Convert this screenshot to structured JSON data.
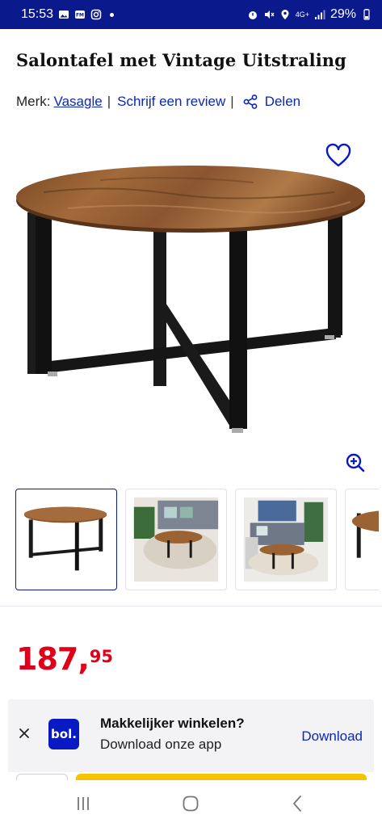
{
  "status_bar": {
    "time": "15:53",
    "network": "4G+",
    "battery": "29%"
  },
  "product": {
    "title": "Salontafel met Vintage Uitstraling",
    "brand_label": "Merk:",
    "brand": "Vasagle",
    "separator": "|",
    "review_link": "Schrijf een review",
    "share_link": "Delen"
  },
  "price": {
    "euros": "187",
    "comma": ",",
    "cents": "95"
  },
  "app_banner": {
    "logo_text": "bol.",
    "heading": "Makkelijker winkelen?",
    "subtext": "Download onze app",
    "download_label": "Download"
  },
  "colors": {
    "status_bar_bg": "#0a1a8c",
    "link_blue": "#0a27b8",
    "price_red": "#e0001a",
    "cta_yellow": "#f5c400"
  },
  "icons": [
    "photo-icon",
    "fm-icon",
    "instagram-icon",
    "alarm-icon",
    "mute-icon",
    "location-icon",
    "signal-icon",
    "battery-icon",
    "share-icon",
    "heart-icon",
    "zoom-in-icon",
    "close-icon",
    "recents-icon",
    "home-icon",
    "back-icon"
  ]
}
